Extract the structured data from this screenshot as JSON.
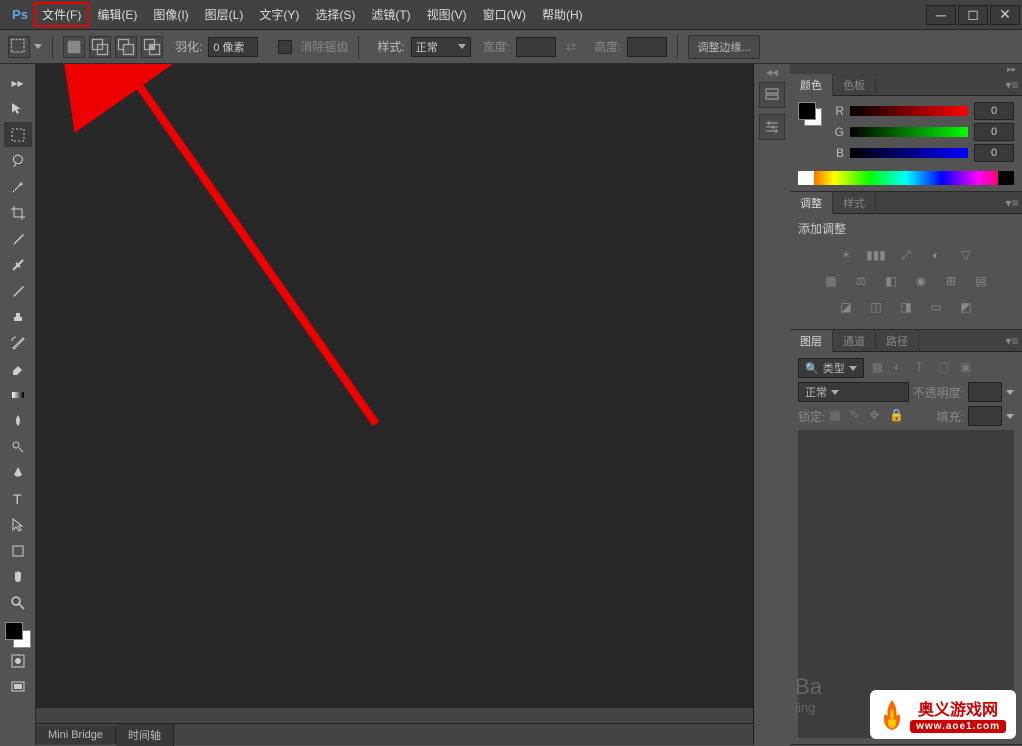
{
  "menu": {
    "file": "文件(F)",
    "edit": "编辑(E)",
    "image": "图像(I)",
    "layer": "图层(L)",
    "type": "文字(Y)",
    "select": "选择(S)",
    "filter": "滤镜(T)",
    "view": "视图(V)",
    "window": "窗口(W)",
    "help": "帮助(H)"
  },
  "logo": "Ps",
  "options": {
    "feather_label": "羽化:",
    "feather_value": "0 像素",
    "antialias": "消除锯齿",
    "style_label": "样式:",
    "style_value": "正常",
    "width_label": "宽度:",
    "width_value": "",
    "height_label": "高度:",
    "height_value": "",
    "refine_edge": "调整边缘..."
  },
  "bottom_tabs": {
    "mini_bridge": "Mini Bridge",
    "timeline": "时间轴"
  },
  "panels": {
    "color": {
      "tab_color": "颜色",
      "tab_swatches": "色板",
      "r_label": "R",
      "r_value": "0",
      "g_label": "G",
      "g_value": "0",
      "b_label": "B",
      "b_value": "0"
    },
    "adjustments": {
      "tab_adjustments": "调整",
      "tab_styles": "样式",
      "add_label": "添加调整"
    },
    "layers": {
      "tab_layers": "图层",
      "tab_channels": "通道",
      "tab_paths": "路径",
      "kind": "类型",
      "blend_mode": "正常",
      "opacity_label": "不透明度:",
      "opacity_value": "",
      "lock_label": "锁定:",
      "fill_label": "填充:",
      "fill_value": ""
    }
  },
  "watermark": {
    "site_name": "奥义游戏网",
    "url": "www.aoe1.com",
    "baidu": "Ba",
    "jing": "jing"
  }
}
